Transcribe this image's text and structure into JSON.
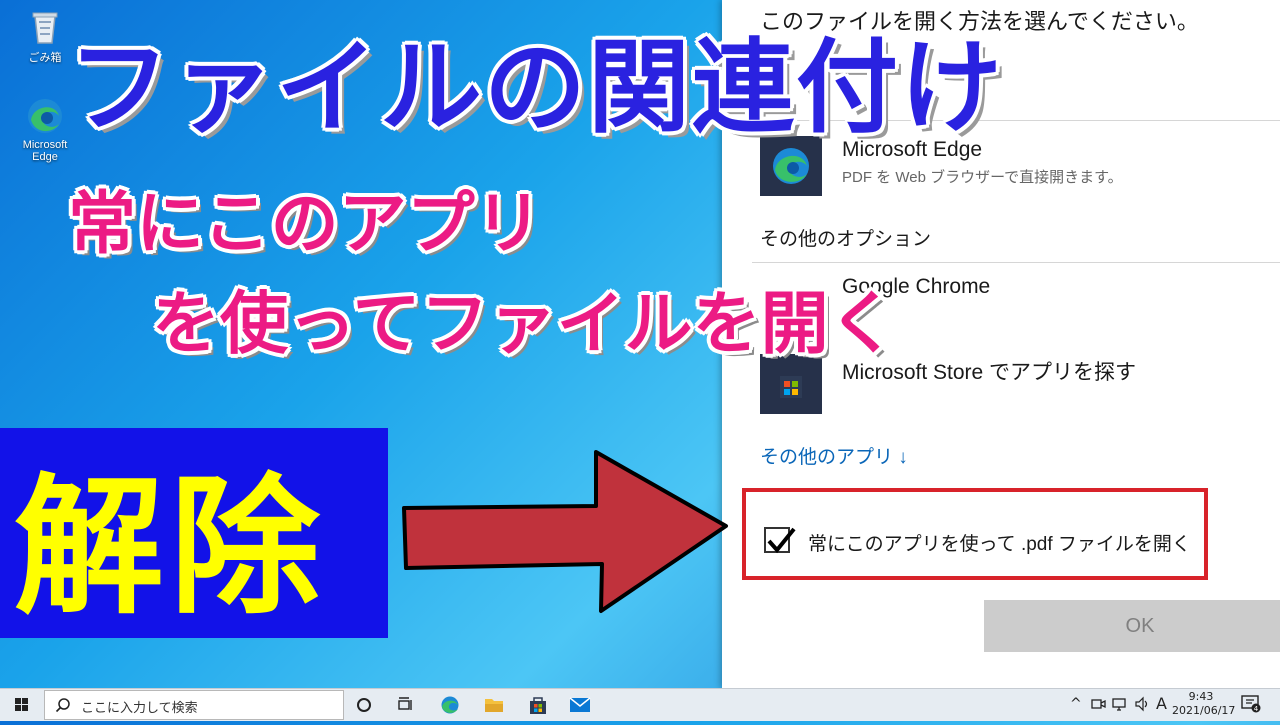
{
  "desktop": {
    "recycle_bin_label": "ごみ箱",
    "edge_label": "Microsoft Edge"
  },
  "dialog": {
    "prompt": "このファイルを開く方法を選んでください。",
    "recommended": {
      "name": "Microsoft Edge",
      "desc": "PDF を Web ブラウザーで直接開きます。"
    },
    "other_options_label": "その他のオプション",
    "chrome": {
      "name": "Google Chrome"
    },
    "store": {
      "name": "Microsoft Store でアプリを探す"
    },
    "more_apps": "その他のアプリ ↓",
    "always_use_label": "常にこのアプリを使って .pdf ファイルを開く",
    "always_use_checked": true,
    "ok_label": "OK"
  },
  "overlay": {
    "title": "ファイルの関連付け",
    "subtitle_line1": "常にこのアプリ",
    "subtitle_line2": "を使ってファイルを開く",
    "release": "解除",
    "colors": {
      "title": "#2a22e0",
      "subtitle": "#ec1b84",
      "release_bg": "#1212e8",
      "release_text": "#ffff00",
      "arrow": "#c0323c",
      "highlight": "#d8232a"
    }
  },
  "taskbar": {
    "search_placeholder": "ここに入力して検索",
    "icons": [
      "windows-start-icon",
      "cortana-icon",
      "task-view-icon",
      "edge-icon",
      "file-explorer-icon",
      "store-icon",
      "mail-icon"
    ],
    "ime_indicator": "A",
    "time": "9:43",
    "date": "2021/06/17"
  }
}
